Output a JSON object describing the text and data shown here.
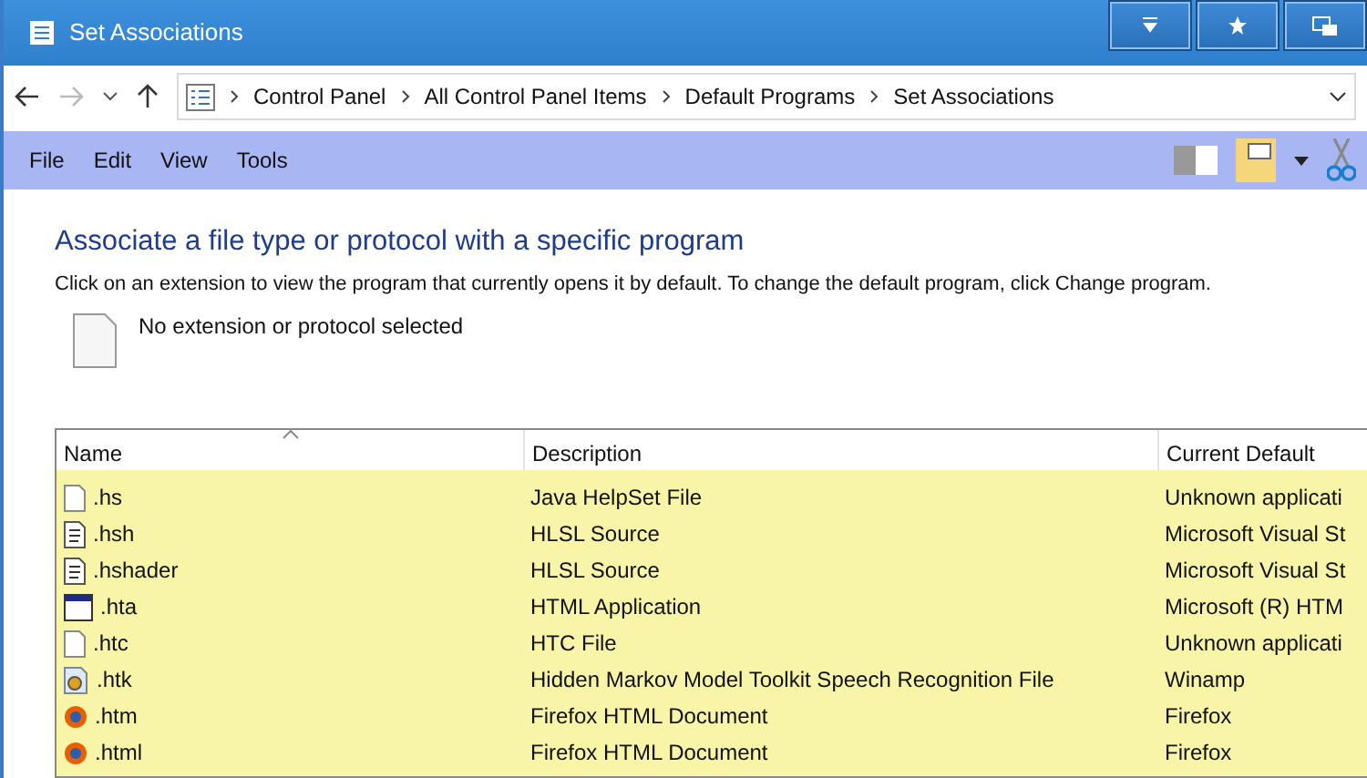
{
  "window": {
    "title": "Set Associations"
  },
  "breadcrumb": [
    "Control Panel",
    "All Control Panel Items",
    "Default Programs",
    "Set Associations"
  ],
  "menu": [
    "File",
    "Edit",
    "View",
    "Tools"
  ],
  "heading": "Associate a file type or protocol with a specific program",
  "description": "Click on an extension to view the program that currently opens it by default. To change the default program, click Change program.",
  "selection": {
    "label": "No extension or protocol selected"
  },
  "table": {
    "columns": [
      "Name",
      "Description",
      "Current Default"
    ],
    "rows": [
      {
        "kind": "blank",
        "name": ".hs",
        "description": "Java HelpSet File",
        "default": "Unknown applicati"
      },
      {
        "kind": "source",
        "name": ".hsh",
        "description": "HLSL Source",
        "default": "Microsoft Visual St"
      },
      {
        "kind": "source",
        "name": ".hshader",
        "description": "HLSL Source",
        "default": "Microsoft Visual St"
      },
      {
        "kind": "app",
        "name": ".hta",
        "description": "HTML Application",
        "default": "Microsoft (R) HTM"
      },
      {
        "kind": "blank",
        "name": ".htc",
        "description": "HTC File",
        "default": "Unknown applicati"
      },
      {
        "kind": "media",
        "name": ".htk",
        "description": "Hidden Markov Model Toolkit Speech Recognition File",
        "default": "Winamp"
      },
      {
        "kind": "browser",
        "name": ".htm",
        "description": "Firefox HTML Document",
        "default": "Firefox"
      },
      {
        "kind": "browser",
        "name": ".html",
        "description": "Firefox HTML Document",
        "default": "Firefox"
      }
    ]
  }
}
